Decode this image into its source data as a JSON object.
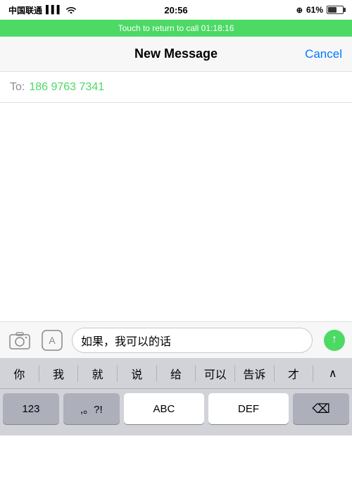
{
  "statusBar": {
    "carrier": "中国联通",
    "time": "20:56",
    "signal": "▋▋▋",
    "wifi": "wifi",
    "battery": "61%"
  },
  "returnBanner": {
    "text": "Touch to return to call 01:18:16"
  },
  "navBar": {
    "title": "New Message",
    "cancelLabel": "Cancel"
  },
  "toField": {
    "label": "To:",
    "value": "186 9763 7341"
  },
  "toolbar": {
    "cameraLabel": "camera",
    "appstoreLabel": "appstore",
    "inputText": "如果，我可以的话",
    "sendLabel": "↑"
  },
  "predictive": {
    "words": [
      "你",
      "我",
      "就",
      "说",
      "给",
      "可以",
      "告诉",
      "才",
      "∧"
    ]
  },
  "keyboard": {
    "row1": [
      "你",
      "我",
      "就",
      "说",
      "给",
      "可以",
      "告诉",
      "才",
      "∧"
    ],
    "row2_label": "123",
    "row2_punct": ",。?!",
    "row2_abc": "ABC",
    "row2_def": "DEF",
    "row2_delete": "⌫"
  }
}
